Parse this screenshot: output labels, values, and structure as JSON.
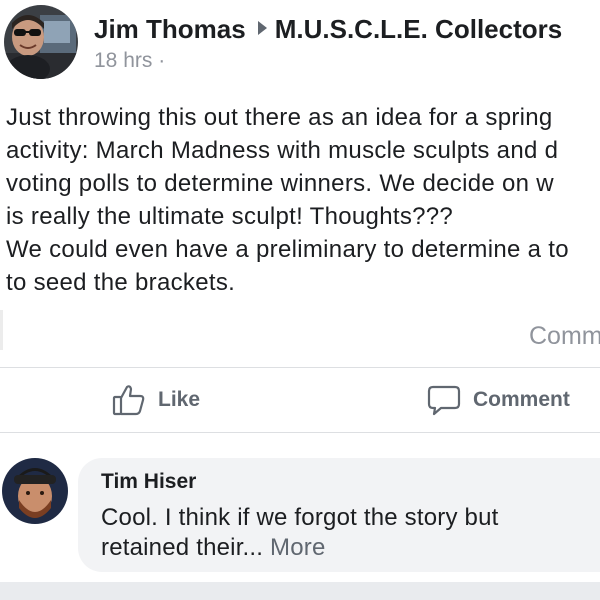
{
  "post": {
    "author": "Jim Thomas",
    "group": "M.U.S.C.L.E. Collectors",
    "time": "18 hrs",
    "time_separator": " ·",
    "body_lines": [
      "Just throwing this out there as an idea for a spring",
      "activity: March Madness with muscle sculpts and d",
      "voting polls to determine winners. We decide on w",
      "is really the ultimate sculpt! Thoughts???",
      "We could even have a preliminary to determine a to",
      "to seed the brackets."
    ],
    "comments_count_label": "Comm"
  },
  "actions": {
    "like_label": "Like",
    "comment_label": "Comment"
  },
  "comment": {
    "author": "Tim Hiser",
    "text_lines": [
      "Cool. I think if we forgot the story but",
      "retained their..."
    ],
    "more_label": "More"
  },
  "colors": {
    "text_primary": "#1c1e21",
    "text_secondary": "#606770",
    "meta": "#90949c",
    "bubble": "#f2f3f5",
    "divider": "#dddfe2"
  }
}
